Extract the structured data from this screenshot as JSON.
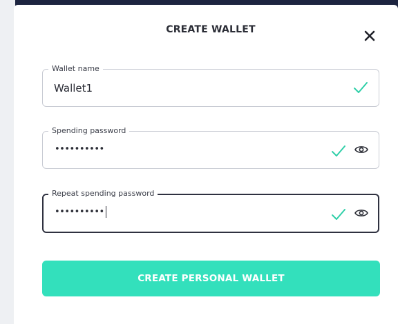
{
  "dialog": {
    "title": "CREATE WALLET",
    "close_icon": "close-icon"
  },
  "fields": {
    "wallet_name": {
      "label": "Wallet name",
      "value": "Wallet1",
      "valid": true
    },
    "spending_password": {
      "label": "Spending password",
      "masked_value": "••••••••••",
      "valid": true,
      "visibility_icon": "eye-icon"
    },
    "repeat_password": {
      "label": "Repeat spending password",
      "masked_value": "••••••••••",
      "valid": true,
      "focused": true,
      "visibility_icon": "eye-icon"
    }
  },
  "actions": {
    "create_label": "CREATE PERSONAL WALLET"
  },
  "colors": {
    "accent": "#33e0bc",
    "valid_check": "#2fcfa8",
    "backdrop": "#1d2440"
  }
}
